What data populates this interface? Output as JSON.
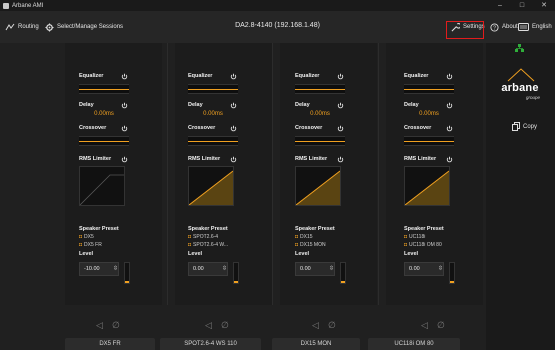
{
  "window": {
    "title": "Arbane AMI",
    "controls": [
      "–",
      "□",
      "✕"
    ]
  },
  "toolbar": {
    "routing_label": "Routing",
    "sessions_label": "Select/Manage Sessions",
    "device": "DA2.8-4140 (192.168.1.48)",
    "settings_label": "Settings",
    "about_label": "About",
    "language_label": "English"
  },
  "labels": {
    "equalizer": "Equalizer",
    "delay": "Delay",
    "crossover": "Crossover",
    "rms_limiter": "RMS Limiter",
    "speaker_preset": "Speaker Preset",
    "level": "Level"
  },
  "channels": [
    {
      "delay": "0.00ms",
      "preset_1": "DX5",
      "preset_2": "DX5 FR",
      "level": "-10.00",
      "name": "DX5 FR"
    },
    {
      "delay": "0.00ms",
      "preset_1": "SPOT2.6-4",
      "preset_2": "SPOT2.6-4 W...",
      "level": "0.00",
      "name": "SPOT2.6-4 WS 110"
    },
    {
      "delay": "0.00ms",
      "preset_1": "DX15",
      "preset_2": "DX15 MON",
      "level": "0.00",
      "name": "DX15 MON"
    },
    {
      "delay": "0.00ms",
      "preset_1": "UC118i",
      "preset_2": "UC118i OM 80",
      "level": "0.00",
      "name": "UC118i OM 80"
    }
  ],
  "sidebar": {
    "logo": "arbane",
    "logo_sub": "groupe",
    "copy_label": "Copy"
  },
  "colors": {
    "accent": "#f0a020",
    "highlight": "#e21c1c",
    "logo_green": "#2fae3a"
  }
}
